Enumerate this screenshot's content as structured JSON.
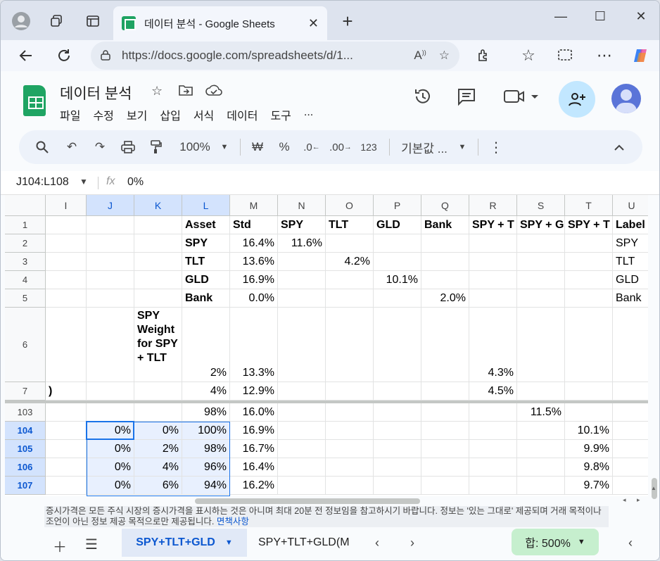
{
  "browser": {
    "tab_title": "데이터 분석 - Google Sheets",
    "url": "https://docs.google.com/spreadsheets/d/1...",
    "new_tab": "+",
    "minimize": "—",
    "maximize": "☐",
    "close": "✕"
  },
  "doc": {
    "title": "데이터 분석",
    "menu": [
      "파일",
      "수정",
      "보기",
      "삽입",
      "서식",
      "데이터",
      "도구",
      "..."
    ]
  },
  "toolbar": {
    "zoom": "100%",
    "currency": "₩",
    "percent": "%",
    "dec_decrease": ".0",
    "dec_increase": ".00",
    "number_format": "123",
    "font": "기본값 ..."
  },
  "formula_bar": {
    "name_box": "J104:L108",
    "fx": "fx",
    "value": "0%"
  },
  "columns": [
    "I",
    "J",
    "K",
    "L",
    "M",
    "N",
    "O",
    "P",
    "Q",
    "R",
    "S",
    "T",
    "U"
  ],
  "selected_columns": [
    "J",
    "K",
    "L"
  ],
  "rows": [
    {
      "n": "1",
      "cells": {
        "L": "Asset",
        "M": "Std",
        "N": "SPY",
        "O": "TLT",
        "P": "GLD",
        "Q": "Bank",
        "R": "SPY + T",
        "S": "SPY + G",
        "T": "SPY + T",
        "U": "Label"
      }
    },
    {
      "n": "2",
      "cells": {
        "L": "SPY",
        "M": "16.4%",
        "N": "11.6%",
        "U": "SPY"
      }
    },
    {
      "n": "3",
      "cells": {
        "L": "TLT",
        "M": "13.6%",
        "O": "4.2%",
        "U": "TLT"
      }
    },
    {
      "n": "4",
      "cells": {
        "L": "GLD",
        "M": "16.9%",
        "P": "10.1%",
        "U": "GLD"
      }
    },
    {
      "n": "5",
      "cells": {
        "L": "Bank",
        "M": "0.0%",
        "Q": "2.0%",
        "U": "Bank"
      }
    },
    {
      "n": "6",
      "cells": {
        "K": "SPY Weight for SPY + TLT",
        "L": "2%",
        "M": "13.3%",
        "R": "4.3%"
      }
    },
    {
      "n": "7",
      "cells": {
        "I": ")",
        "L": "4%",
        "M": "12.9%",
        "R": "4.5%"
      }
    },
    {
      "n": "103",
      "cells": {
        "L": "98%",
        "M": "16.0%",
        "S": "11.5%"
      }
    },
    {
      "n": "104",
      "cells": {
        "J": "0%",
        "K": "0%",
        "L": "100%",
        "M": "16.9%",
        "T": "10.1%"
      }
    },
    {
      "n": "105",
      "cells": {
        "J": "0%",
        "K": "2%",
        "L": "98%",
        "M": "16.7%",
        "T": "9.9%"
      }
    },
    {
      "n": "106",
      "cells": {
        "J": "0%",
        "K": "4%",
        "L": "96%",
        "M": "16.4%",
        "T": "9.8%"
      }
    },
    {
      "n": "107",
      "cells": {
        "J": "0%",
        "K": "6%",
        "L": "94%",
        "M": "16.2%",
        "T": "9.7%"
      }
    }
  ],
  "disclaimer": {
    "text": "증시가격은 모든 주식 시장의 증시가격을 표시하는 것은 아니며 최대 20분 전 정보임을 참고하시기 바랍니다. 정보는 '있는 그대로' 제공되며 거래 목적이나 조언이 아닌 정보 제공 목적으로만 제공됩니다.",
    "link": "면책사항"
  },
  "sheets": {
    "active": "SPY+TLT+GLD",
    "other": "SPY+TLT+GLD(M",
    "sum": "합: 500%"
  }
}
